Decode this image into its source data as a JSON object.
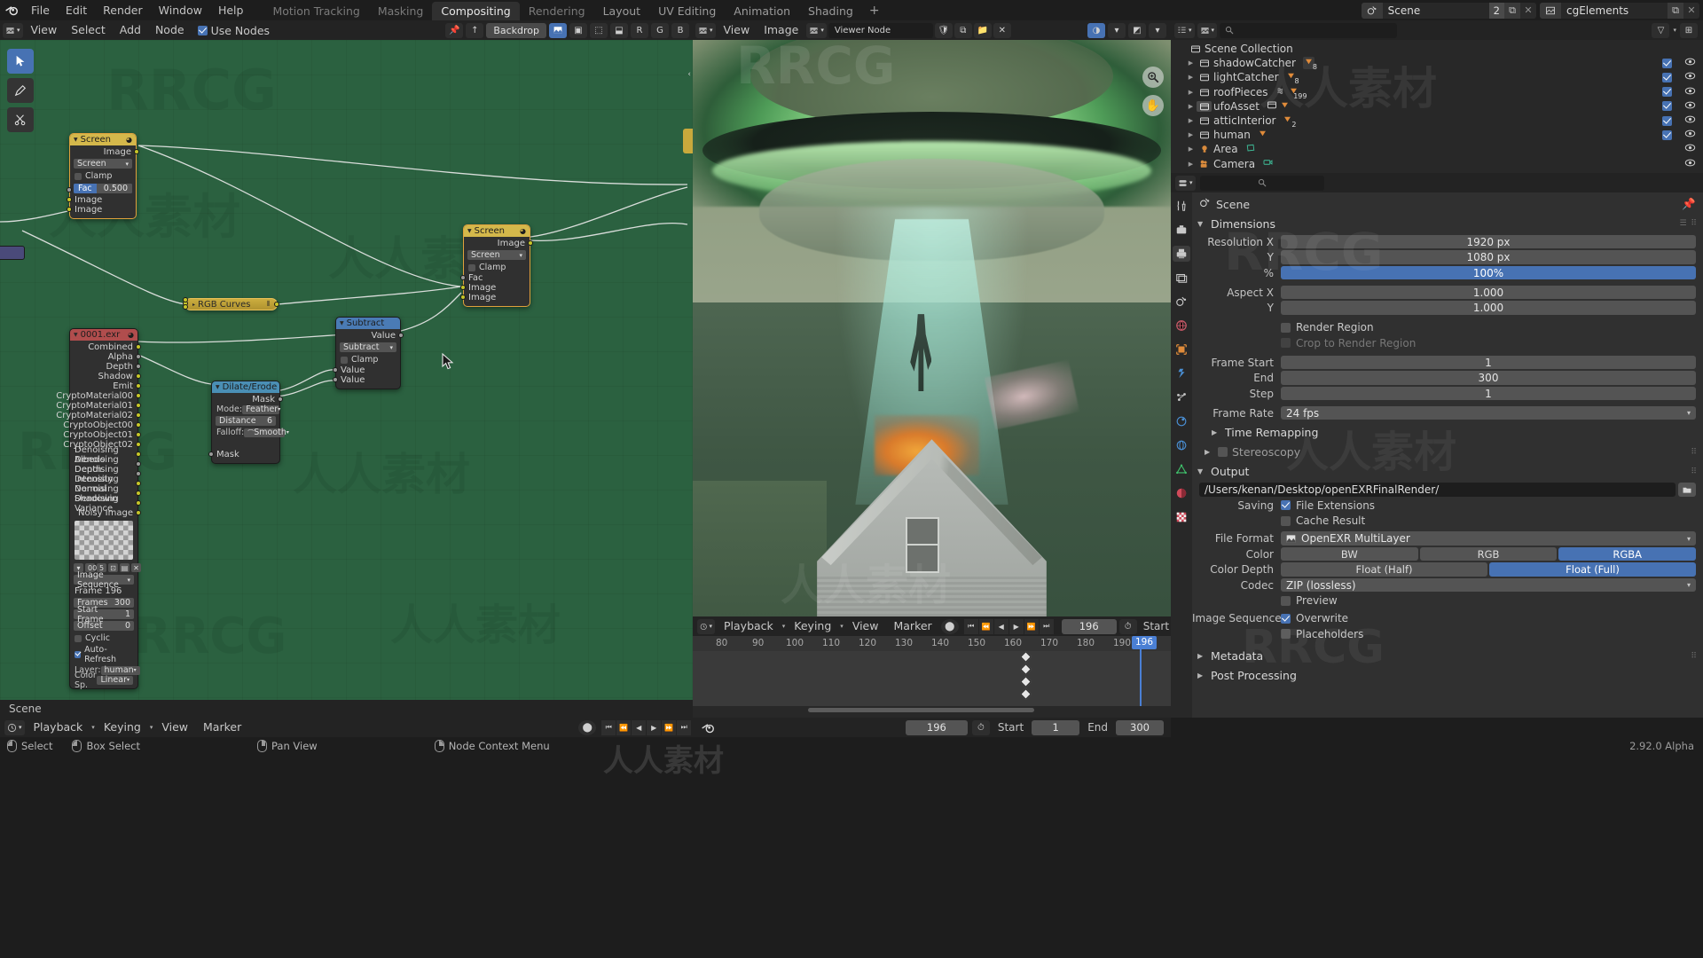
{
  "app": {
    "title": "Blender",
    "version": "2.92.0 Alpha"
  },
  "topbar": {
    "menus": [
      "File",
      "Edit",
      "Render",
      "Window",
      "Help"
    ],
    "workspaces": [
      {
        "label": "Motion Tracking",
        "active": false
      },
      {
        "label": "Masking",
        "active": false
      },
      {
        "label": "Compositing",
        "active": true
      },
      {
        "label": "Rendering",
        "active": false
      },
      {
        "label": "Layout",
        "active": false
      },
      {
        "label": "UV Editing",
        "active": false
      },
      {
        "label": "Animation",
        "active": false
      },
      {
        "label": "Shading",
        "active": false
      }
    ],
    "add_workspace": "+",
    "scene_name": "Scene",
    "scene_users": "2",
    "viewlayer_name": "cgElements"
  },
  "node_editor": {
    "header": {
      "view": "View",
      "select": "Select",
      "add": "Add",
      "node": "Node",
      "use_nodes_label": "Use Nodes",
      "use_nodes_checked": true,
      "backdrop_label": "Backdrop",
      "channels": [
        "R",
        "G",
        "B"
      ]
    },
    "footer_label": "Scene",
    "nodes": [
      {
        "id": "screen-top",
        "title": "Screen",
        "type": "mix",
        "output_label": "Image",
        "blend_mode": "Screen",
        "clamp_label": "Clamp",
        "clamp_checked": false,
        "fac_label": "Fac",
        "fac_value": "0.500",
        "input_labels": [
          "Image",
          "Image"
        ]
      },
      {
        "id": "screen-mid",
        "title": "Screen",
        "type": "mix",
        "output_label": "Image",
        "blend_mode": "Screen",
        "clamp_label": "Clamp",
        "clamp_checked": false,
        "fac_label": "Fac",
        "input_labels": [
          "Image",
          "Image"
        ]
      },
      {
        "id": "rgb-curves",
        "title": "RGB Curves",
        "type": "collapsed"
      },
      {
        "id": "subtract",
        "title": "Subtract",
        "type": "math",
        "output_label": "Value",
        "operation": "Subtract",
        "clamp_label": "Clamp",
        "clamp_checked": false,
        "input_labels": [
          "Value",
          "Value"
        ]
      },
      {
        "id": "dilate-erode",
        "title": "Dilate/Erode",
        "type": "filter",
        "output_label": "Mask",
        "mode_label": "Mode:",
        "mode_value": "Feather",
        "distance_label": "Distance",
        "distance_value": "6",
        "falloff_label": "Falloff:",
        "falloff_value": "Smooth",
        "input_labels": [
          "Mask"
        ]
      },
      {
        "id": "image-node",
        "title": "0001.exr",
        "type": "image",
        "outputs": [
          "Combined",
          "Alpha",
          "Depth",
          "Shadow",
          "Emit",
          "CryptoMaterial00",
          "CryptoMaterial01",
          "CryptoMaterial02",
          "CryptoObject00",
          "CryptoObject01",
          "CryptoObject02",
          "Denoising Albedo",
          "Denoising Depth",
          "Denoising Intensity",
          "Denoising Normal",
          "Denoising Shadowin",
          "Denoising Variance",
          "Noisy Image"
        ],
        "source": "Image Sequence",
        "frame_label": "Frame 196",
        "frames_label": "Frames",
        "frames_value": "300",
        "start_frame_label": "Start Frame",
        "start_frame_value": "1",
        "offset_label": "Offset",
        "offset_value": "0",
        "cyclic_label": "Cyclic",
        "cyclic_checked": false,
        "auto_refresh_label": "Auto-Refresh",
        "auto_refresh_checked": true,
        "layer_label": "Layer:",
        "layer_value": "human",
        "colorspace_label": "Color Sp.",
        "colorspace_value": "Linear",
        "browse_count": "00",
        "browse_users": "5"
      }
    ]
  },
  "image_editor": {
    "header": {
      "view": "View",
      "image": "Image",
      "node_name": "Viewer Node"
    }
  },
  "timeline": {
    "header": {
      "playback": "Playback",
      "keying": "Keying",
      "view": "View",
      "marker": "Marker",
      "frame_current": "196",
      "start_label": "Start"
    },
    "ruler_ticks": [
      "80",
      "90",
      "100",
      "110",
      "120",
      "130",
      "140",
      "150",
      "160",
      "170",
      "180",
      "190"
    ],
    "playhead_frame": "196"
  },
  "bottom_timeline": {
    "playback": "Playback",
    "keying": "Keying",
    "view": "View",
    "marker": "Marker",
    "frame_current": "196",
    "start_label": "Start",
    "start_value": "1",
    "end_label": "End",
    "end_value": "300"
  },
  "outliner": {
    "root": "Scene Collection",
    "items": [
      {
        "name": "shadowCatcher",
        "icon": "collection-icon",
        "badges": [
          "mesh-data"
        ],
        "badge_count": "8",
        "checkbox": true,
        "eye": true
      },
      {
        "name": "lightCatcher",
        "icon": "collection-icon",
        "badges": [
          "mesh-data"
        ],
        "badge_count": "8",
        "checkbox": true,
        "eye": true
      },
      {
        "name": "roofPieces",
        "icon": "collection-icon",
        "badges": [
          "modifier",
          "mesh-data"
        ],
        "badge_count": "199",
        "checkbox": true,
        "eye": true
      },
      {
        "name": "ufoAsset",
        "icon": "collection-icon",
        "badges": [
          "collection",
          "mesh-data"
        ],
        "badge_count": "",
        "checkbox": true,
        "eye": true
      },
      {
        "name": "atticInterior",
        "icon": "collection-icon",
        "badges": [
          "mesh-data"
        ],
        "badge_count": "2",
        "checkbox": true,
        "eye": true
      },
      {
        "name": "human",
        "icon": "collection-icon",
        "badges": [
          "mesh-data"
        ],
        "badge_count": "",
        "checkbox": true,
        "eye": true
      },
      {
        "name": "Area",
        "icon": "light-icon",
        "badges": [
          "light-data"
        ],
        "badge_count": "",
        "checkbox": false,
        "eye": true
      },
      {
        "name": "Camera",
        "icon": "camera-icon",
        "badges": [
          "camera-data"
        ],
        "badge_count": "",
        "checkbox": false,
        "eye": true
      }
    ]
  },
  "properties": {
    "breadcrumb": "Scene",
    "dimensions": {
      "title": "Dimensions",
      "rows": [
        {
          "label": "Resolution X",
          "value": "1920 px",
          "style": "normal"
        },
        {
          "label": "Y",
          "value": "1080 px",
          "style": "normal"
        },
        {
          "label": "%",
          "value": "100%",
          "style": "blue"
        },
        {
          "label": "Aspect X",
          "value": "1.000",
          "style": "normal"
        },
        {
          "label": "Y",
          "value": "1.000",
          "style": "normal"
        }
      ],
      "render_region_label": "Render Region",
      "render_region_checked": false,
      "crop_label": "Crop to Render Region",
      "crop_checked": false,
      "frame_rows": [
        {
          "label": "Frame Start",
          "value": "1"
        },
        {
          "label": "End",
          "value": "300"
        },
        {
          "label": "Step",
          "value": "1"
        }
      ],
      "frame_rate_label": "Frame Rate",
      "frame_rate_value": "24 fps",
      "time_remapping": "Time Remapping",
      "stereoscopy": "Stereoscopy",
      "stereoscopy_checked": false
    },
    "output": {
      "title": "Output",
      "path": "/Users/kenan/Desktop/openEXRFinalRender/",
      "saving_label": "Saving",
      "file_extensions_label": "File Extensions",
      "file_extensions_checked": true,
      "cache_result_label": "Cache Result",
      "cache_result_checked": false,
      "file_format_label": "File Format",
      "file_format_value": "OpenEXR MultiLayer",
      "color_label": "Color",
      "color_options": [
        "BW",
        "RGB",
        "RGBA"
      ],
      "color_selected": "RGBA",
      "color_depth_label": "Color Depth",
      "color_depth_options": [
        "Float (Half)",
        "Float (Full)"
      ],
      "color_depth_selected": "Float (Full)",
      "codec_label": "Codec",
      "codec_value": "ZIP (lossless)",
      "preview_label": "Preview",
      "preview_checked": false,
      "image_sequence_label": "Image Sequence",
      "overwrite_label": "Overwrite",
      "overwrite_checked": true,
      "placeholders_label": "Placeholders",
      "placeholders_checked": false
    },
    "metadata_title": "Metadata",
    "post_processing_title": "Post Processing"
  },
  "status_bar": {
    "items": [
      {
        "icon": "mouse-left-icon",
        "label": "Select"
      },
      {
        "icon": "mouse-drag-icon",
        "label": "Box Select"
      },
      {
        "icon": "mouse-middle-icon",
        "label": "Pan View"
      },
      {
        "icon": "mouse-right-icon",
        "label": "Node Context Menu"
      }
    ],
    "version": "2.92.0 Alpha"
  },
  "colors": {
    "accent_blue": "#4772b3",
    "node_yellow": "#b39b3f",
    "node_red": "#b04d4d",
    "node_blue": "#4a7bb5",
    "canvas_green": "#2b6140",
    "panel_bg": "#303030",
    "header_bg": "#232323"
  },
  "watermarks": [
    "RRCG",
    "人人素材"
  ]
}
